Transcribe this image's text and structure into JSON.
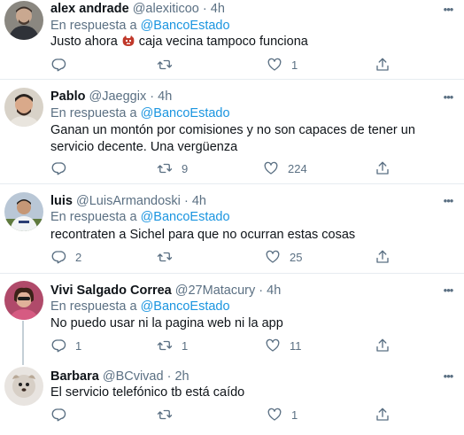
{
  "colors": {
    "link": "#1b95e0",
    "muted": "#5b7083",
    "text": "#0f1419",
    "divider": "#e6ecf0"
  },
  "tweets": [
    {
      "name": "alex andrade",
      "handle": "@alexiticoo",
      "dot": "·",
      "time": "4h",
      "reply_prefix": "En respuesta a",
      "reply_to": "@BancoEstado",
      "text_before": "Justo ahora",
      "emoji": "angry-face-emoji",
      "text_after": "caja vecina tampoco funciona",
      "replies": "",
      "retweets": "",
      "likes": "1"
    },
    {
      "name": "Pablo",
      "handle": "@Jaeggix",
      "dot": "·",
      "time": "4h",
      "reply_prefix": "En respuesta a",
      "reply_to": "@BancoEstado",
      "text": "Ganan un montón por comisiones y no son capaces de tener un servicio decente. Una vergüenza",
      "replies": "",
      "retweets": "9",
      "likes": "224"
    },
    {
      "name": "luis",
      "handle": "@LuisArmandoski",
      "dot": "·",
      "time": "4h",
      "reply_prefix": "En respuesta a",
      "reply_to": "@BancoEstado",
      "text": "recontraten a Sichel para que no ocurran estas cosas",
      "replies": "2",
      "retweets": "",
      "likes": "25"
    },
    {
      "name": "Vivi Salgado Correa",
      "handle": "@27Matacury",
      "dot": "·",
      "time": "4h",
      "reply_prefix": "En respuesta a",
      "reply_to": "@BancoEstado",
      "text": "No puedo  usar ni  la pagina web  ni  la app",
      "replies": "1",
      "retweets": "1",
      "likes": "11"
    },
    {
      "name": "Barbara",
      "handle": "@BCvivad",
      "dot": "·",
      "time": "2h",
      "text": "El servicio telefónico tb está caído",
      "replies": "",
      "retweets": "",
      "likes": "1"
    }
  ]
}
